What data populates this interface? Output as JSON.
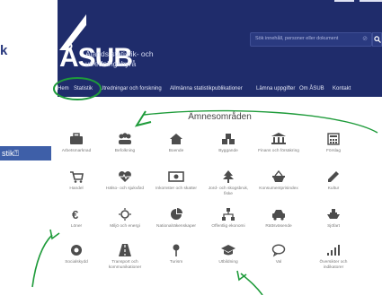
{
  "side_fragments": {
    "left_heading_fragment": "k",
    "left_tab_fragment": "stik⍰"
  },
  "logo": {
    "letters": "ÅSUB",
    "name_line1": "Ålands statistik- och",
    "name_line2": "utredningsbyrå"
  },
  "search": {
    "placeholder": "Sök innehåll, personer eller dokument",
    "clear_symbol": "⊘",
    "button_icon": "search-icon"
  },
  "nav": {
    "items": [
      "Hem",
      "Statistik",
      "Utredningar och forskning",
      "Allmänna statistikpublikationer",
      "Lämna uppgifter",
      "Om ÅSUB",
      "Kontakt"
    ]
  },
  "section_title": "Ämnesområden",
  "topics": [
    {
      "label": "Arbetsmarknad",
      "icon": "briefcase-icon"
    },
    {
      "label": "Befolkning",
      "icon": "people-icon"
    },
    {
      "label": "Boende",
      "icon": "home-icon"
    },
    {
      "label": "Byggande",
      "icon": "cubes-icon"
    },
    {
      "label": "Finans och försäkring",
      "icon": "bank-icon"
    },
    {
      "label": "Förslag",
      "icon": "calculator-icon"
    },
    {
      "label": "Handel",
      "icon": "cart-icon"
    },
    {
      "label": "Hälso- och sjukvård",
      "icon": "heartbeat-icon"
    },
    {
      "label": "Inkomster och skatter",
      "icon": "money-icon"
    },
    {
      "label": "Jord- och skogsbruk, fiske",
      "icon": "tree-icon"
    },
    {
      "label": "Konsumentprisindex",
      "icon": "basket-icon"
    },
    {
      "label": "Kultur",
      "icon": "pencil-icon"
    },
    {
      "label": "Löner",
      "icon": "euro-icon"
    },
    {
      "label": "Miljö och energi",
      "icon": "sun-icon"
    },
    {
      "label": "Nationalräkenskaper",
      "icon": "pie-chart-icon"
    },
    {
      "label": "Offentlig ekonomi",
      "icon": "sitemap-icon"
    },
    {
      "label": "Rättsväsende",
      "icon": "car-icon"
    },
    {
      "label": "Sjöfart",
      "icon": "ship-icon"
    },
    {
      "label": "Socialskydd",
      "icon": "lifebuoy-icon"
    },
    {
      "label": "Transport och kommunikationer",
      "icon": "road-icon"
    },
    {
      "label": "Turism",
      "icon": "map-pin-icon"
    },
    {
      "label": "Utbildning",
      "icon": "graduation-cap-icon"
    },
    {
      "label": "Val",
      "icon": "speech-bubble-icon"
    },
    {
      "label": "Översikter och indikatorer",
      "icon": "bar-signal-icon"
    }
  ],
  "colors": {
    "header_bg": "#1f2c6b",
    "annotation_green": "#1e9b3a",
    "tile_icon": "#4d4d4d",
    "tab_fragment_bg": "#3e5fa8"
  }
}
